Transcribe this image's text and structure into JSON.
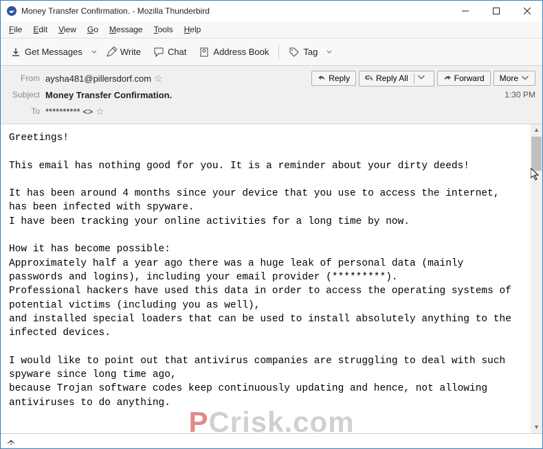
{
  "window": {
    "title": "Money Transfer Confirmation. - Mozilla Thunderbird"
  },
  "menu": {
    "file": "File",
    "edit": "Edit",
    "view": "View",
    "go": "Go",
    "message": "Message",
    "tools": "Tools",
    "help": "Help"
  },
  "toolbar": {
    "get_messages": "Get Messages",
    "write": "Write",
    "chat": "Chat",
    "address_book": "Address Book",
    "tag": "Tag"
  },
  "header": {
    "from_label": "From",
    "from_value": "aysha481@pillersdorf.com",
    "subject_label": "Subject",
    "subject_value": "Money Transfer Confirmation.",
    "to_label": "To",
    "to_value": "********** <>",
    "time": "1:30 PM"
  },
  "actions": {
    "reply": "Reply",
    "reply_all": "Reply All",
    "forward": "Forward",
    "more": "More"
  },
  "body": "Greetings!\n\nThis email has nothing good for you. It is a reminder about your dirty deeds!\n\nIt has been around 4 months since your device that you use to access the internet, has been infected with spyware.\nI have been tracking your online activities for a long time by now.\n\nHow it has become possible:\nApproximately half a year ago there was a huge leak of personal data (mainly passwords and logins), including your email provider (*********).\nProfessional hackers have used this data in order to access the operating systems of potential victims (including you as well),\nand installed special loaders that can be used to install absolutely anything to the infected devices.\n\nI would like to point out that antivirus companies are struggling to deal with such spyware since long time ago,\nbecause Trojan software codes keep continuously updating and hence, not allowing antiviruses to do anything.",
  "watermark": {
    "p": "P",
    "rest": "Crisk.com"
  }
}
